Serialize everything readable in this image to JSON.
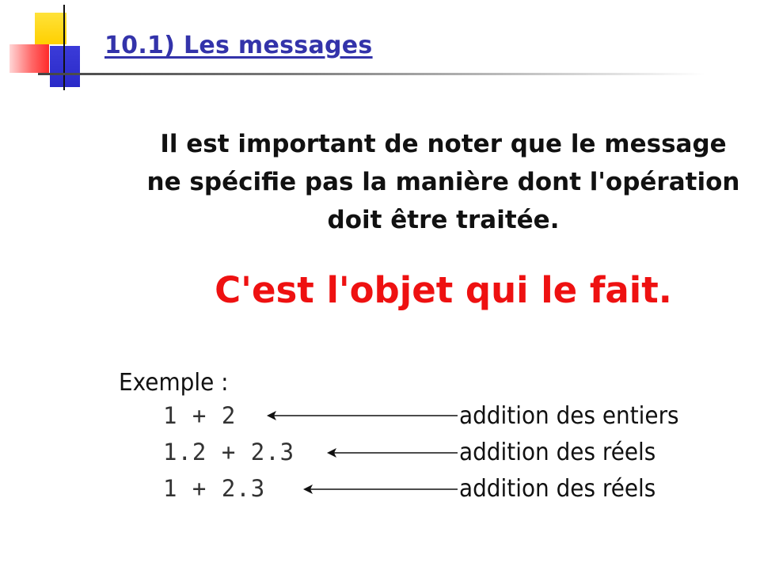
{
  "slide": {
    "title": "10.1) Les messages",
    "note": "Il est important de noter que le message ne spécifie pas la manière dont l'opération doit être traitée.",
    "highlight": "C'est l'objet qui le fait.",
    "example_label": "Exemple :",
    "examples": [
      {
        "expression": "1 + 2",
        "description": "addition des entiers"
      },
      {
        "expression": "1.2 + 2.3",
        "description": "addition des réels"
      },
      {
        "expression": "1 + 2.3",
        "description": "addition des réels"
      }
    ]
  },
  "colors": {
    "title": "#3333aa",
    "highlight": "#ee1111",
    "accent_yellow": "#ffd000",
    "accent_red": "#ff3333",
    "accent_blue": "#2a2ac8"
  }
}
